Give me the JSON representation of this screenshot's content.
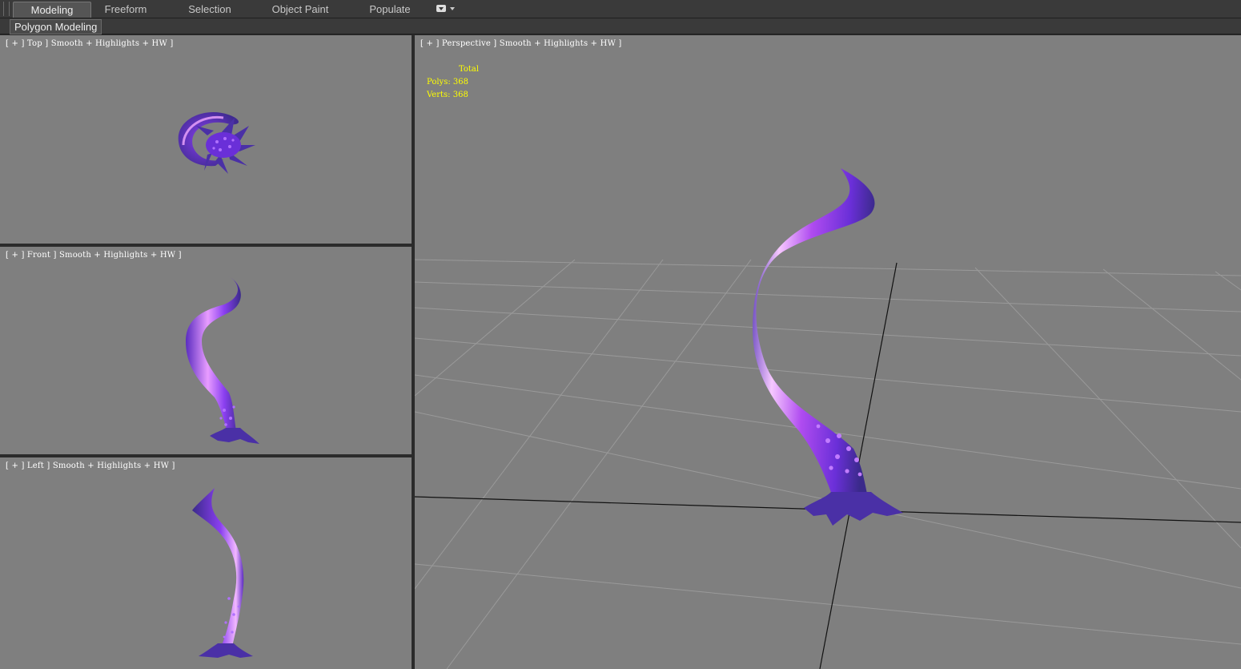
{
  "ribbon": {
    "tabs": [
      {
        "label": "Modeling",
        "active": true
      },
      {
        "label": "Freeform",
        "active": false
      },
      {
        "label": "Selection",
        "active": false
      },
      {
        "label": "Object Paint",
        "active": false
      },
      {
        "label": "Populate",
        "active": false
      }
    ],
    "sub_tab": "Polygon Modeling"
  },
  "viewports": {
    "top": {
      "label": "[ + ] Top ] Smooth + Highlights + HW ]"
    },
    "front": {
      "label": "[ + ] Front ] Smooth + Highlights + HW ]"
    },
    "left": {
      "label": "[ + ] Left ] Smooth + Highlights + HW ]"
    },
    "perspective": {
      "label": "[ + ] Perspective ] Smooth + Highlights + HW ]"
    }
  },
  "stats": {
    "header": "Total",
    "polys_label": "Polys:",
    "polys_value": "368",
    "verts_label": "Verts:",
    "verts_value": "368"
  },
  "colors": {
    "viewport_bg": "#7f7f7f",
    "stats_text": "#ffff00",
    "tentacle_dark": "#3a2a8a",
    "tentacle_mid": "#7a2ee0",
    "tentacle_highlight": "#f2b8ff"
  }
}
